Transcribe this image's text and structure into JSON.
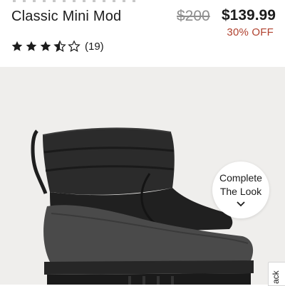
{
  "product": {
    "title": "Classic Mini Mod",
    "original_price": "$200",
    "sale_price": "$139.99",
    "discount": "30% OFF",
    "rating": 3.5,
    "rating_max": 5,
    "review_count": "(19)"
  },
  "complete_look": {
    "line1": "Complete",
    "line2": "The Look",
    "icon": "chevron-down-icon"
  },
  "feedback_tab": {
    "label": "ack"
  },
  "colors": {
    "discount": "#b0412e",
    "product_bg": "#efeeec",
    "boot": "#2a2a2a"
  }
}
